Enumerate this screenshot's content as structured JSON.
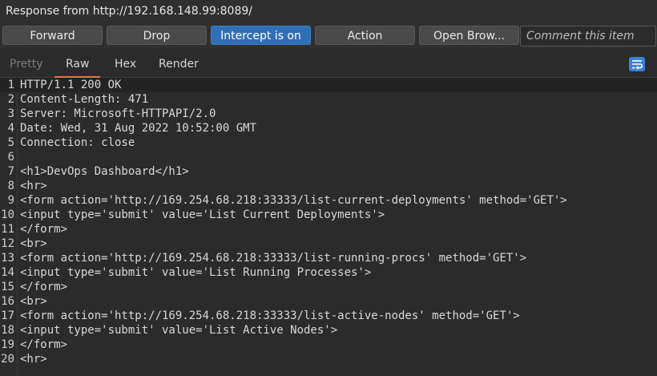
{
  "title": "Response from http://192.168.148.99:8089/",
  "toolbar": {
    "forward": "Forward",
    "drop": "Drop",
    "intercept": "Intercept is on",
    "action": "Action",
    "open_browser": "Open Brow...",
    "comment_placeholder": "Comment this item"
  },
  "tabs": [
    "Pretty",
    "Raw",
    "Hex",
    "Render"
  ],
  "selected_tab": "Raw",
  "icons": {
    "wrap": "wrap-lines-icon"
  },
  "colors": {
    "accent": "#2f6fb5",
    "tab_underline": "#e8734a"
  },
  "lines": [
    {
      "n": "1",
      "text": "HTTP/1.1 200 OK"
    },
    {
      "n": "2",
      "text": "Content-Length: 471"
    },
    {
      "n": "3",
      "text": "Server: Microsoft-HTTPAPI/2.0"
    },
    {
      "n": "4",
      "text": "Date: Wed, 31 Aug 2022 10:52:00 GMT"
    },
    {
      "n": "5",
      "text": "Connection: close"
    },
    {
      "n": "6",
      "text": ""
    },
    {
      "n": "7",
      "text": "<h1>DevOps Dashboard</h1>"
    },
    {
      "n": "8",
      "text": "<hr>"
    },
    {
      "n": "9",
      "text": "<form action='http://169.254.68.218:33333/list-current-deployments' method='GET'>"
    },
    {
      "n": "10",
      "text": "<input type='submit' value='List Current Deployments'>"
    },
    {
      "n": "11",
      "text": "</form>"
    },
    {
      "n": "12",
      "text": "<br>"
    },
    {
      "n": "13",
      "text": "<form action='http://169.254.68.218:33333/list-running-procs' method='GET'>"
    },
    {
      "n": "14",
      "text": "<input type='submit' value='List Running Processes'>"
    },
    {
      "n": "15",
      "text": "</form>"
    },
    {
      "n": "16",
      "text": "<br>"
    },
    {
      "n": "17",
      "text": "<form action='http://169.254.68.218:33333/list-active-nodes' method='GET'>"
    },
    {
      "n": "18",
      "text": "<input type='submit' value='List Active Nodes'>"
    },
    {
      "n": "19",
      "text": "</form>"
    },
    {
      "n": "20",
      "text": "<hr>"
    }
  ]
}
